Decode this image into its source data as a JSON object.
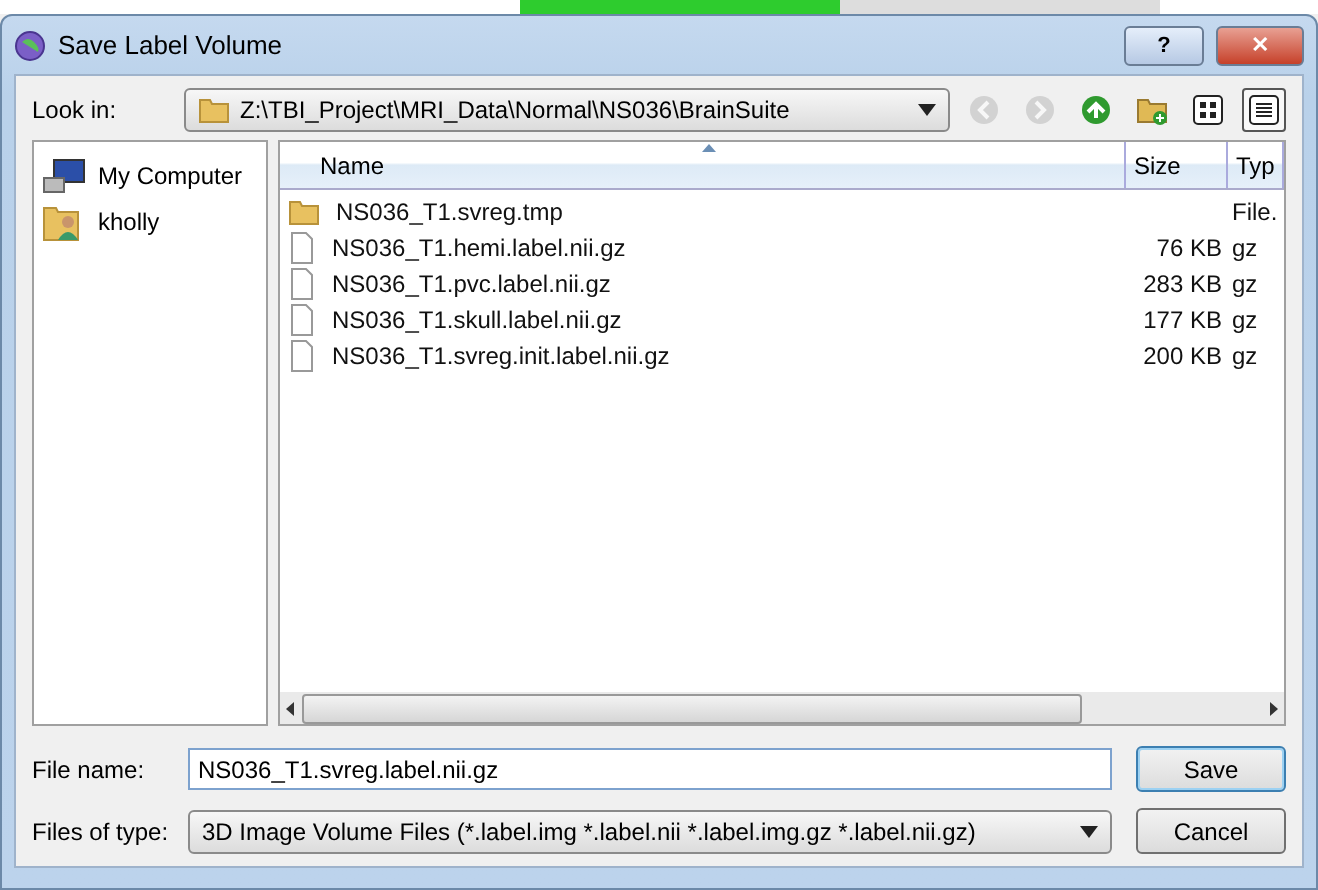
{
  "background_progress": {
    "level": 0.5
  },
  "window": {
    "title": "Save Label Volume",
    "buttons": [
      {
        "kind": "help",
        "label": "?"
      },
      {
        "kind": "close",
        "label": "✕"
      }
    ]
  },
  "look_in": {
    "label": "Look in:",
    "path": "Z:\\TBI_Project\\MRI_Data\\Normal\\NS036\\BrainSuite",
    "toolbar": [
      {
        "kind": "back",
        "disabled": true
      },
      {
        "kind": "forward",
        "disabled": true
      },
      {
        "kind": "up",
        "disabled": false
      },
      {
        "kind": "new-folder",
        "disabled": false
      },
      {
        "kind": "list-view",
        "disabled": false,
        "selected": false
      },
      {
        "kind": "detail-view",
        "disabled": false,
        "selected": true
      }
    ]
  },
  "sidebar": {
    "items": [
      {
        "kind": "computer",
        "label": "My Computer"
      },
      {
        "kind": "user",
        "label": "kholly"
      }
    ]
  },
  "table": {
    "columns": [
      {
        "label": "Name",
        "sorted": true
      },
      {
        "label": "Size",
        "sorted": false
      },
      {
        "label": "Typ",
        "sorted": false
      }
    ],
    "rows": [
      {
        "kind": "folder",
        "name": "NS036_T1.svreg.tmp",
        "size": "",
        "type": "File."
      },
      {
        "kind": "file",
        "name": "NS036_T1.hemi.label.nii.gz",
        "size": "76 KB",
        "type": "gz"
      },
      {
        "kind": "file",
        "name": "NS036_T1.pvc.label.nii.gz",
        "size": "283 KB",
        "type": "gz"
      },
      {
        "kind": "file",
        "name": "NS036_T1.skull.label.nii.gz",
        "size": "177 KB",
        "type": "gz"
      },
      {
        "kind": "file",
        "name": "NS036_T1.svreg.init.label.nii.gz",
        "size": "200 KB",
        "type": "gz"
      }
    ]
  },
  "file_name": {
    "label": "File name:",
    "value": "NS036_T1.svreg.label.nii.gz"
  },
  "file_type": {
    "label": "Files of type:",
    "value": "3D Image Volume Files (*.label.img *.label.nii *.label.img.gz *.label.nii.gz)"
  },
  "actions": [
    {
      "kind": "primary",
      "label": "Save"
    },
    {
      "kind": "secondary",
      "label": "Cancel"
    }
  ]
}
